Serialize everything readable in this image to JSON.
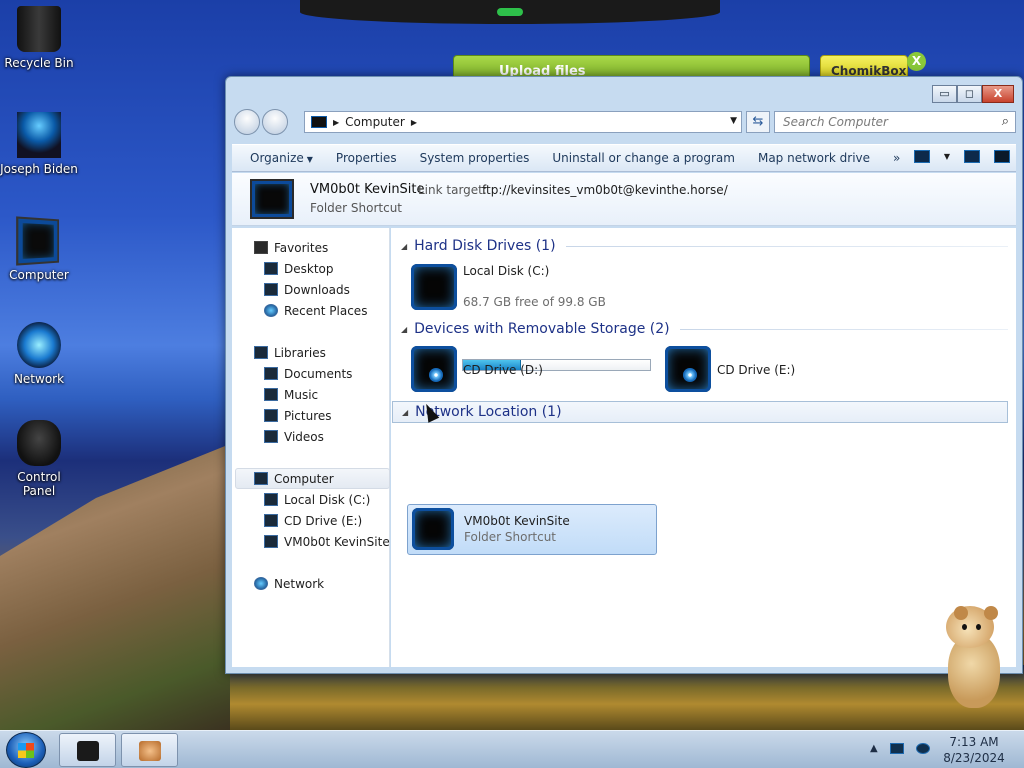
{
  "desktop": {
    "icons": [
      {
        "label": "Recycle Bin"
      },
      {
        "label": "Joseph Biden"
      },
      {
        "label": "Computer"
      },
      {
        "label": "Network"
      },
      {
        "label": "Control Panel"
      }
    ],
    "upload_label": "Upload files",
    "chomik_label": "ChomikBox",
    "chomik_close": "X"
  },
  "window": {
    "caption": {
      "minimize": "▭",
      "maximize": "◻",
      "close": "X"
    },
    "address": {
      "path": "Computer",
      "sep_icon": "▶"
    },
    "search_placeholder": "Search Computer",
    "toolbar": {
      "organize": "Organize",
      "properties": "Properties",
      "system_properties": "System properties",
      "uninstall": "Uninstall or change a program",
      "map_drive": "Map network drive",
      "more": "»"
    },
    "details": {
      "name": "VM0b0t KevinSite",
      "link_target_label": "Link target:",
      "link_target": "ftp://kevinsites_vm0b0t@kevinthe.horse/",
      "type": "Folder Shortcut"
    },
    "nav": {
      "favorites": "Favorites",
      "desktop": "Desktop",
      "downloads": "Downloads",
      "recent": "Recent Places",
      "libraries": "Libraries",
      "documents": "Documents",
      "music": "Music",
      "pictures": "Pictures",
      "videos": "Videos",
      "computer": "Computer",
      "local_disk": "Local Disk (C:)",
      "cd_e": "CD Drive (E:)",
      "kevinsite": "VM0b0t KevinSite",
      "network": "Network"
    },
    "groups": {
      "hdd": "Hard Disk Drives (1)",
      "removable": "Devices with Removable Storage (2)",
      "network": "Network Location (1)"
    },
    "items": {
      "local_disk": {
        "name": "Local Disk (C:)",
        "free": "68.7 GB free of 99.8 GB",
        "used_fraction": 0.312
      },
      "cd_d": {
        "name": "CD Drive (D:)"
      },
      "cd_e": {
        "name": "CD Drive (E:)"
      },
      "kevinsite": {
        "name": "VM0b0t KevinSite",
        "type": "Folder Shortcut"
      }
    }
  },
  "taskbar": {
    "time": "7:13 AM",
    "date": "8/23/2024",
    "tray_arrow": "▲"
  }
}
